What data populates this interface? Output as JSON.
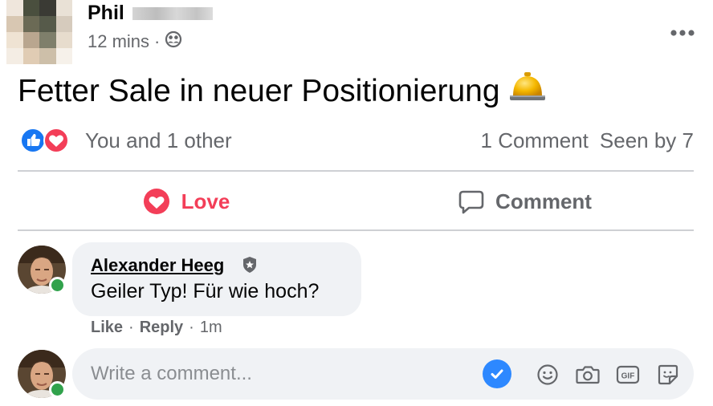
{
  "post": {
    "author": "Phil",
    "time": "12 mins",
    "meta_separator": "·",
    "audience_icon": "friends-icon",
    "more_icon": "ellipsis",
    "text": "Fetter Sale in neuer Positionierung",
    "emoji_icon": "bellhop-bell-icon"
  },
  "reactions": {
    "icons": [
      "like",
      "love"
    ],
    "summary": "You and 1 other",
    "comments": "1 Comment",
    "seen": "Seen by 7"
  },
  "actions": {
    "love_label": "Love",
    "comment_label": "Comment"
  },
  "comment": {
    "author": "Alexander Heeg",
    "badge_icon": "shield-star-icon",
    "text": "Geiler Typ! Für wie hoch?",
    "like_label": "Like",
    "reply_label": "Reply",
    "time": "1m",
    "separator": "·"
  },
  "composer": {
    "placeholder": "Write a comment...",
    "tools": [
      "emoji-icon",
      "camera-icon",
      "gif-icon",
      "sticker-icon"
    ]
  },
  "colors": {
    "love": "#f33e58",
    "like": "#1877f2",
    "secondary_text": "#65676b",
    "bubble": "#f0f2f5",
    "online": "#31a24c",
    "check": "#2d88ff"
  }
}
